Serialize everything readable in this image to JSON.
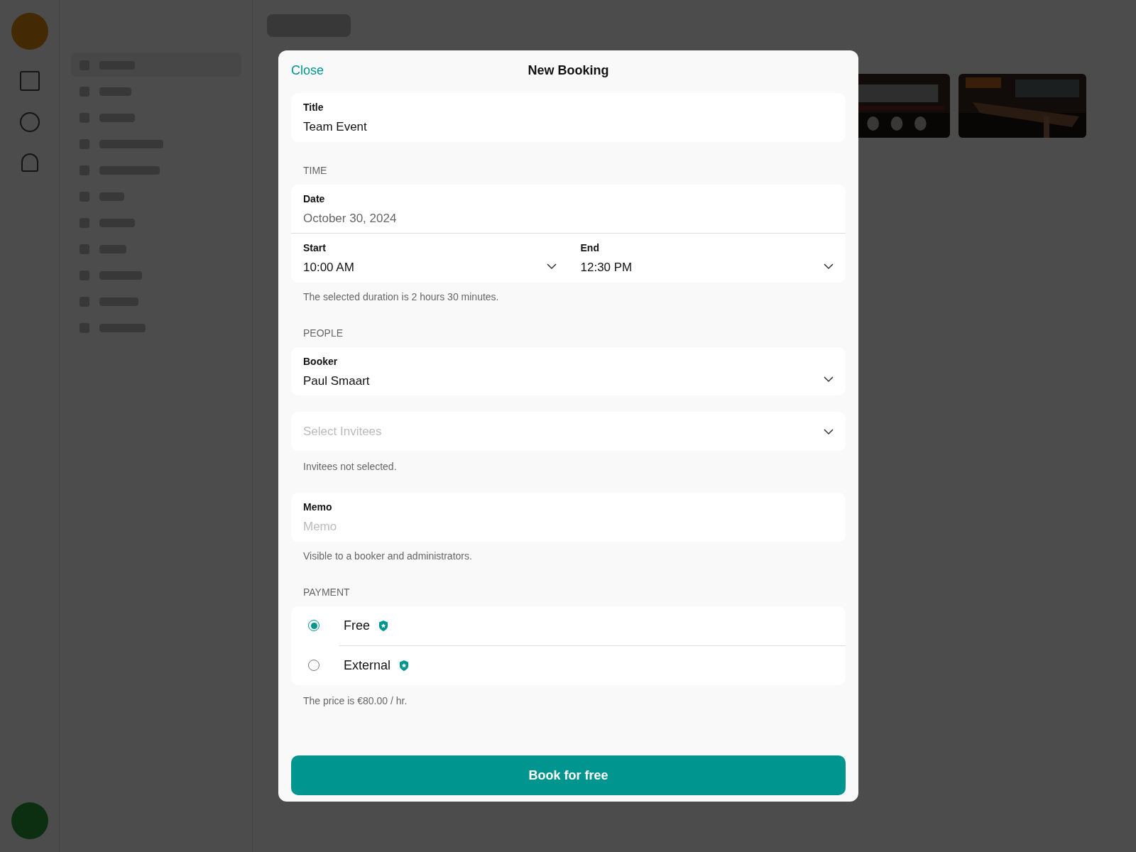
{
  "modal": {
    "close": "Close",
    "title": "New Booking",
    "title_field": {
      "label": "Title",
      "value": "Team Event"
    },
    "time": {
      "heading": "TIME",
      "date": {
        "label": "Date",
        "value": "October 30, 2024"
      },
      "start": {
        "label": "Start",
        "value": "10:00 AM"
      },
      "end": {
        "label": "End",
        "value": "12:30 PM"
      },
      "note": "The selected duration is 2 hours 30 minutes."
    },
    "people": {
      "heading": "PEOPLE",
      "booker": {
        "label": "Booker",
        "value": "Paul Smaart"
      },
      "invitees": {
        "placeholder": "Select Invitees"
      },
      "note": "Invitees not selected."
    },
    "memo": {
      "label": "Memo",
      "placeholder": "Memo",
      "note": "Visible to a booker and administrators."
    },
    "payment": {
      "heading": "PAYMENT",
      "options": [
        {
          "label": "Free",
          "selected": true
        },
        {
          "label": "External",
          "selected": false
        }
      ],
      "note": "The price is €80.00 / hr."
    },
    "submit": "Book for free"
  }
}
